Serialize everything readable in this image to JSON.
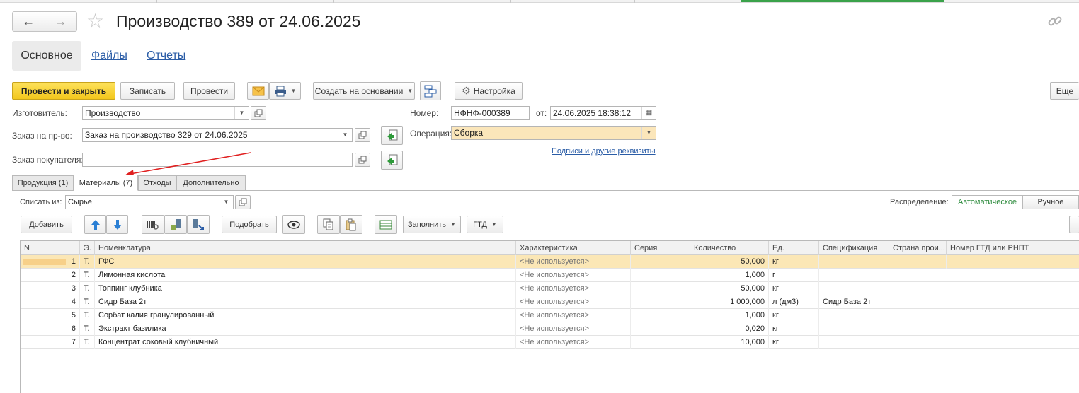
{
  "window": {
    "title": "Производство 389 от 24.06.2025"
  },
  "sections": {
    "main": "Основное",
    "files": "Файлы",
    "reports": "Отчеты"
  },
  "toolbar": {
    "post_close": "Провести и закрыть",
    "save": "Записать",
    "post": "Провести",
    "create_based": "Создать на основании",
    "settings": "Настройка",
    "more": "Еще"
  },
  "form": {
    "manufacturer_label": "Изготовитель:",
    "manufacturer_value": "Производство",
    "production_order_label": "Заказ на пр-во:",
    "production_order_value": "Заказ на производство 329 от 24.06.2025",
    "customer_order_label": "Заказ покупателя:",
    "customer_order_value": "",
    "number_label": "Номер:",
    "number_value": "НФНФ-000389",
    "date_label": "от:",
    "date_value": "24.06.2025 18:38:12",
    "operation_label": "Операция:",
    "operation_value": "Сборка",
    "signatures_link": "Подписи и другие реквизиты"
  },
  "tabs": [
    {
      "label": "Продукция (1)"
    },
    {
      "label": "Материалы (7)"
    },
    {
      "label": "Отходы"
    },
    {
      "label": "Дополнительно"
    }
  ],
  "materials": {
    "writeoff_label": "Списать из:",
    "writeoff_value": "Сырье",
    "distribution_label": "Распределение:",
    "distribution_auto": "Автоматическое",
    "distribution_manual": "Ручное",
    "buttons": {
      "add": "Добавить",
      "pick": "Подобрать",
      "fill": "Заполнить",
      "gtd": "ГТД"
    },
    "columns": [
      "N",
      "Э.",
      "Номенклатура",
      "Характеристика",
      "Серия",
      "Количество",
      "Ед.",
      "Спецификация",
      "Страна прои...",
      "Номер ГТД или РНПТ"
    ],
    "rows": [
      {
        "n": "1",
        "e": "Т.",
        "name": "ГФС",
        "char": "<Не используется>",
        "series": "",
        "qty": "50,000",
        "unit": "кг",
        "spec": ""
      },
      {
        "n": "2",
        "e": "Т.",
        "name": "Лимонная кислота",
        "char": "<Не используется>",
        "series": "",
        "qty": "1,000",
        "unit": "г",
        "spec": ""
      },
      {
        "n": "3",
        "e": "Т.",
        "name": "Топпинг клубника",
        "char": "<Не используется>",
        "series": "",
        "qty": "50,000",
        "unit": "кг",
        "spec": ""
      },
      {
        "n": "4",
        "e": "Т.",
        "name": "Сидр База 2т",
        "char": "<Не используется>",
        "series": "",
        "qty": "1 000,000",
        "unit": "л (дм3)",
        "spec": "Сидр База 2т"
      },
      {
        "n": "5",
        "e": "Т.",
        "name": "Сорбат калия гранулированный",
        "char": "<Не используется>",
        "series": "",
        "qty": "1,000",
        "unit": "кг",
        "spec": ""
      },
      {
        "n": "6",
        "e": "Т.",
        "name": "Экстракт базилика",
        "char": "<Не используется>",
        "series": "",
        "qty": "0,020",
        "unit": "кг",
        "spec": ""
      },
      {
        "n": "7",
        "e": "Т.",
        "name": "Концентрат соковый клубничный",
        "char": "<Не используется>",
        "series": "",
        "qty": "10,000",
        "unit": "кг",
        "spec": ""
      }
    ]
  },
  "colors": {
    "accent_yellow": "#f3c71c",
    "link_blue": "#2a5ca6",
    "selection": "#fbe7b6",
    "annotation_red": "#e02020"
  }
}
